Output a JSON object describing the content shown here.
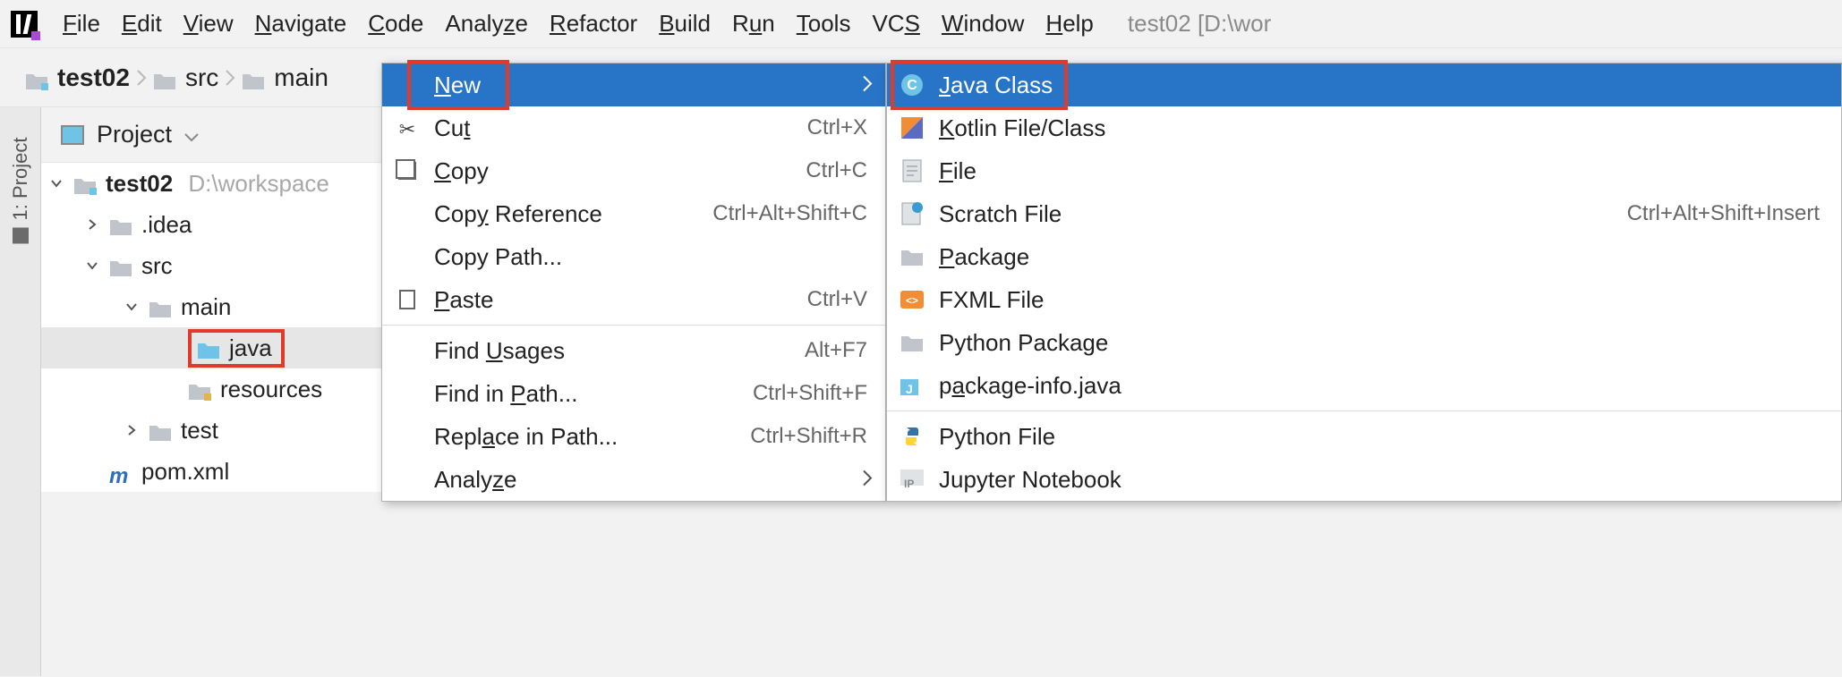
{
  "menubar": {
    "items": [
      "File",
      "Edit",
      "View",
      "Navigate",
      "Code",
      "Analyze",
      "Refactor",
      "Build",
      "Run",
      "Tools",
      "VCS",
      "Window",
      "Help"
    ],
    "mnemonics": [
      "F",
      "E",
      "V",
      "N",
      "C",
      "z",
      "R",
      "B",
      "u",
      "T",
      "S",
      "W",
      "H"
    ],
    "title_path": "test02 [D:\\wor"
  },
  "breadcrumbs": {
    "items": [
      "test02",
      "src",
      "main"
    ]
  },
  "side_tab": {
    "label": "1: Project"
  },
  "project_panel": {
    "title": "Project"
  },
  "tree": {
    "root": {
      "name": "test02",
      "path": "D:\\workspace"
    },
    "nodes": [
      {
        "label": ".idea",
        "depth": 2,
        "arrow": "right",
        "icon": "folder"
      },
      {
        "label": "src",
        "depth": 2,
        "arrow": "down",
        "icon": "folder"
      },
      {
        "label": "main",
        "depth": 3,
        "arrow": "down",
        "icon": "folder"
      },
      {
        "label": "java",
        "depth": 4,
        "arrow": "",
        "icon": "src-folder",
        "selected": true,
        "highlighted": true
      },
      {
        "label": "resources",
        "depth": 4,
        "arrow": "",
        "icon": "res-folder"
      },
      {
        "label": "test",
        "depth": 3,
        "arrow": "right",
        "icon": "folder"
      },
      {
        "label": "pom.xml",
        "depth": 2,
        "arrow": "",
        "icon": "maven"
      }
    ]
  },
  "context_menu": {
    "items": [
      {
        "icon": "",
        "label": "New",
        "shortcut": "",
        "submenu": true,
        "highlighted": true,
        "mn": "N"
      },
      {
        "icon": "scissors",
        "label": "Cut",
        "shortcut": "Ctrl+X",
        "mn": "t"
      },
      {
        "icon": "copy",
        "label": "Copy",
        "shortcut": "Ctrl+C",
        "mn": "C"
      },
      {
        "icon": "",
        "label": "Copy Reference",
        "shortcut": "Ctrl+Alt+Shift+C",
        "mn": "y"
      },
      {
        "icon": "",
        "label": "Copy Path...",
        "shortcut": ""
      },
      {
        "icon": "paste",
        "label": "Paste",
        "shortcut": "Ctrl+V",
        "mn": "P"
      },
      {
        "divider": true
      },
      {
        "icon": "",
        "label": "Find Usages",
        "shortcut": "Alt+F7",
        "mn": "U"
      },
      {
        "icon": "",
        "label": "Find in Path...",
        "shortcut": "Ctrl+Shift+F",
        "mn": "P"
      },
      {
        "icon": "",
        "label": "Replace in Path...",
        "shortcut": "Ctrl+Shift+R",
        "mn": "a"
      },
      {
        "icon": "",
        "label": "Analyze",
        "shortcut": "",
        "submenu": true,
        "mn": "z"
      }
    ]
  },
  "submenu": {
    "items": [
      {
        "kind": "java-class",
        "label": "Java Class",
        "highlighted": true,
        "mn": "J"
      },
      {
        "kind": "kotlin",
        "label": "Kotlin File/Class",
        "mn": "K"
      },
      {
        "kind": "file",
        "label": "File",
        "mn": "F"
      },
      {
        "kind": "scratch",
        "label": "Scratch File",
        "shortcut": "Ctrl+Alt+Shift+Insert"
      },
      {
        "kind": "package",
        "label": "Package",
        "mn": "P"
      },
      {
        "kind": "fxml",
        "label": "FXML File"
      },
      {
        "kind": "py-package",
        "label": "Python Package"
      },
      {
        "kind": "pkg-info",
        "label": "package-info.java",
        "mn": "a"
      },
      {
        "divider": true
      },
      {
        "kind": "python",
        "label": "Python File"
      },
      {
        "kind": "jupyter",
        "label": "Jupyter Notebook"
      }
    ]
  }
}
